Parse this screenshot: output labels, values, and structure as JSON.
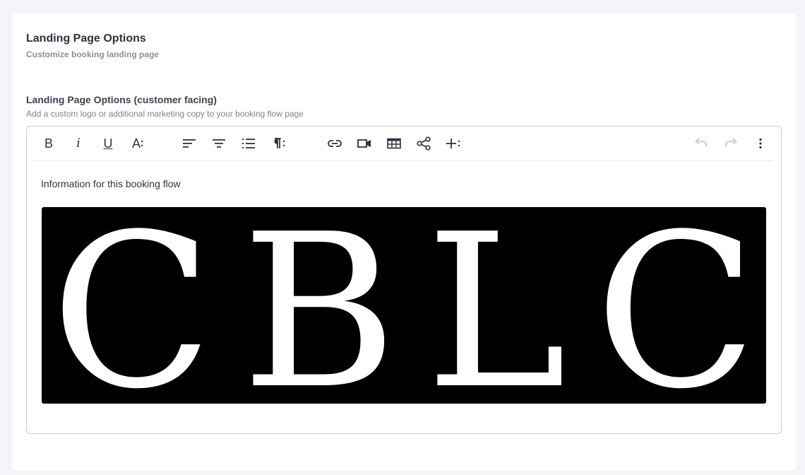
{
  "section": {
    "title": "Landing Page Options",
    "subtitle": "Customize booking landing page"
  },
  "field": {
    "label": "Landing Page Options (customer facing)",
    "help": "Add a custom logo or additional marketing copy to your booking flow page"
  },
  "toolbar": {
    "bold_label": "B",
    "italic_label": "i",
    "underline_label": "U",
    "font_size_label": "A",
    "icons": [
      "bold-icon",
      "italic-icon",
      "underline-icon",
      "font-size-icon",
      "align-left-icon",
      "align-center-icon",
      "ordered-list-icon",
      "paragraph-format-icon",
      "link-icon",
      "video-icon",
      "table-icon",
      "share-icon",
      "more-insert-icon",
      "undo-icon",
      "redo-icon",
      "more-vertical-icon"
    ]
  },
  "editor": {
    "content_text": "Information for this booking flow",
    "logo_text": "CBLC"
  },
  "colors": {
    "accent_text": "#2d3340",
    "muted_text": "#8b919b",
    "border": "#c9ccd2",
    "disabled_icon": "#c3c6cc",
    "logo_background": "#000000",
    "logo_foreground": "#ffffff"
  }
}
